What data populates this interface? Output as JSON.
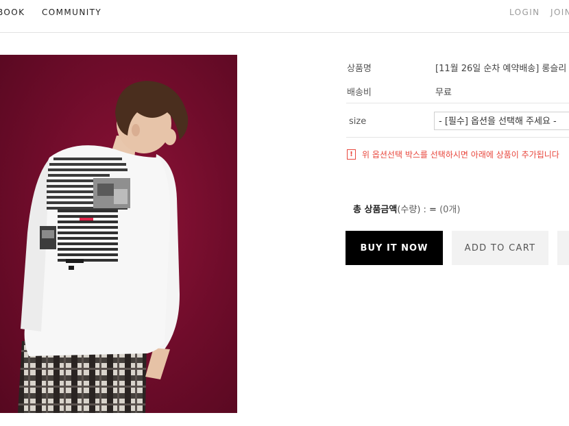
{
  "nav": {
    "left_items": [
      "BOOK",
      "COMMUNITY"
    ],
    "right_items": [
      "LOGIN",
      "JOIN"
    ]
  },
  "product": {
    "image_alt": "white long sleeve tee with printed back graphic",
    "name_label": "상품명",
    "name_value": "[11월 26일 순차 예약배송] 롱슬리",
    "shipping_label": "배송비",
    "shipping_value": "무료",
    "size_label": "size",
    "size_select": "- [필수] 옵션을 선택해 주세요 -",
    "notice_icon": "!",
    "notice": "위 옵션선택 박스를 선택하시면 아래에 상품이 추가됩니다",
    "total_label": "총 상품금액",
    "total_paren": "(수량) :",
    "total_price": "=",
    "total_qty": "(0개)"
  },
  "actions": {
    "buy": "BUY IT NOW",
    "cart": "ADD TO CART"
  },
  "colors": {
    "accent_red": "#e8463c",
    "buy_button": "#000000",
    "backdrop": "#7a0d2e"
  }
}
